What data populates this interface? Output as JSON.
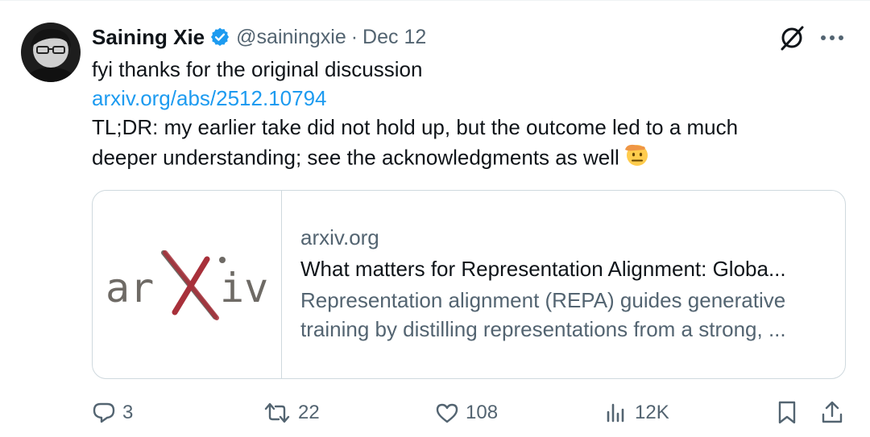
{
  "tweet": {
    "author_name": "Saining Xie",
    "handle": "@sainingxie",
    "separator": "·",
    "date": "Dec 12",
    "line1": "fyi thanks for the original discussion",
    "link": "arxiv.org/abs/2512.10794",
    "line3": "TL;DR: my earlier take did not hold up, but the outcome led to a much",
    "line4": "deeper understanding; see the acknowledgments as well",
    "emoji": "saluting-face",
    "verified_color": "#1d9bf0"
  },
  "card": {
    "logo_text": "arXiv",
    "domain": "arxiv.org",
    "title": "What matters for Representation Alignment: Globa...",
    "desc_line1": "Representation alignment (REPA) guides generative",
    "desc_line2": "training by distilling representations from a strong, ..."
  },
  "actions": {
    "replies": "3",
    "reposts": "22",
    "likes": "108",
    "views": "12K"
  },
  "colors": {
    "accent": "#1d9bf0",
    "muted": "#536471",
    "text": "#0f1419",
    "border": "#cfd9de",
    "arxiv_gray": "#6e6a65",
    "arxiv_red": "#a8303a"
  }
}
